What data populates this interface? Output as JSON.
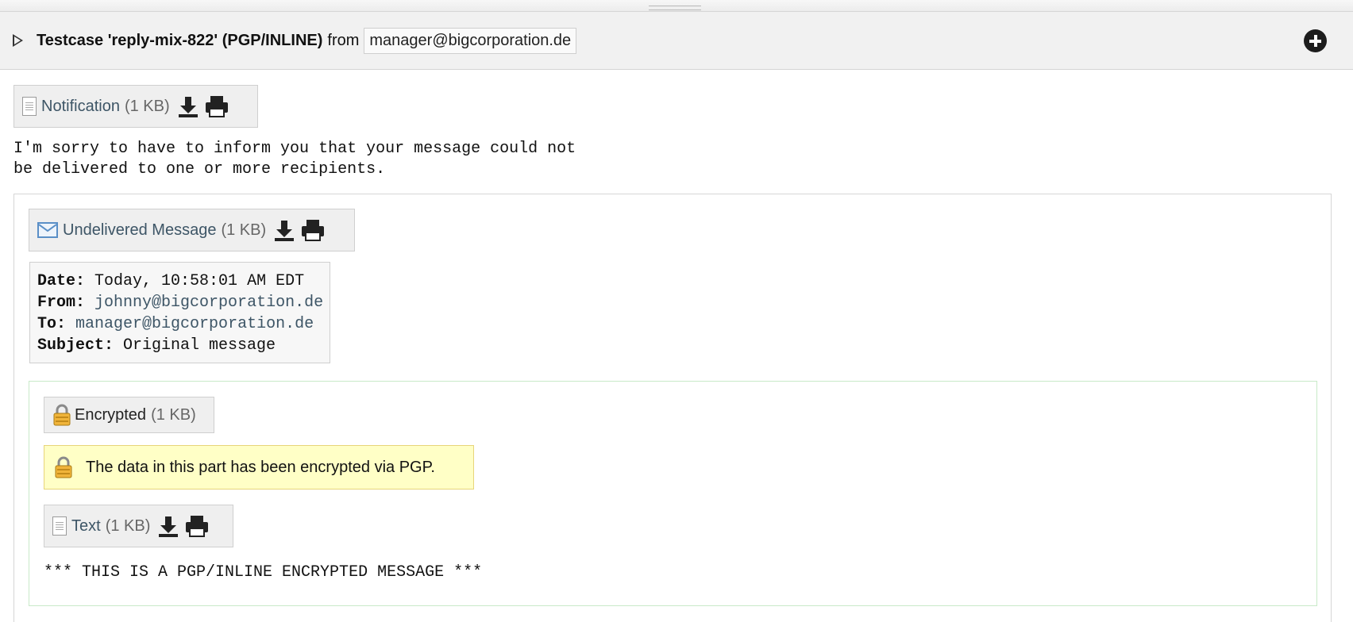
{
  "header": {
    "title": "Testcase 'reply-mix-822' (PGP/INLINE)",
    "from_label": "from",
    "sender": "manager@bigcorporation.de"
  },
  "notification_part": {
    "name": "Notification",
    "size": "(1 KB)"
  },
  "intro_text": "I'm sorry to have to inform you that your message could not\nbe delivered to one or more recipients.",
  "undelivered_part": {
    "name": "Undelivered Message",
    "size": "(1 KB)"
  },
  "message_headers": {
    "date_label": "Date:",
    "date_value": "Today, 10:58:01 AM EDT",
    "from_label": "From:",
    "from_value": "johnny@bigcorporation.de",
    "to_label": "To:",
    "to_value": "manager@bigcorporation.de",
    "subject_label": "Subject:",
    "subject_value": "Original message"
  },
  "encrypted_part": {
    "name": "Encrypted",
    "size": "(1 KB)"
  },
  "encryption_notice": "The data in this part has been encrypted via PGP.",
  "text_part": {
    "name": "Text",
    "size": "(1 KB)"
  },
  "body_text": "*** THIS IS A PGP/INLINE ENCRYPTED MESSAGE ***",
  "icons": [
    "toggle-icon",
    "add-icon",
    "document-icon",
    "download-icon",
    "print-icon",
    "envelope-icon",
    "lock-icon"
  ]
}
